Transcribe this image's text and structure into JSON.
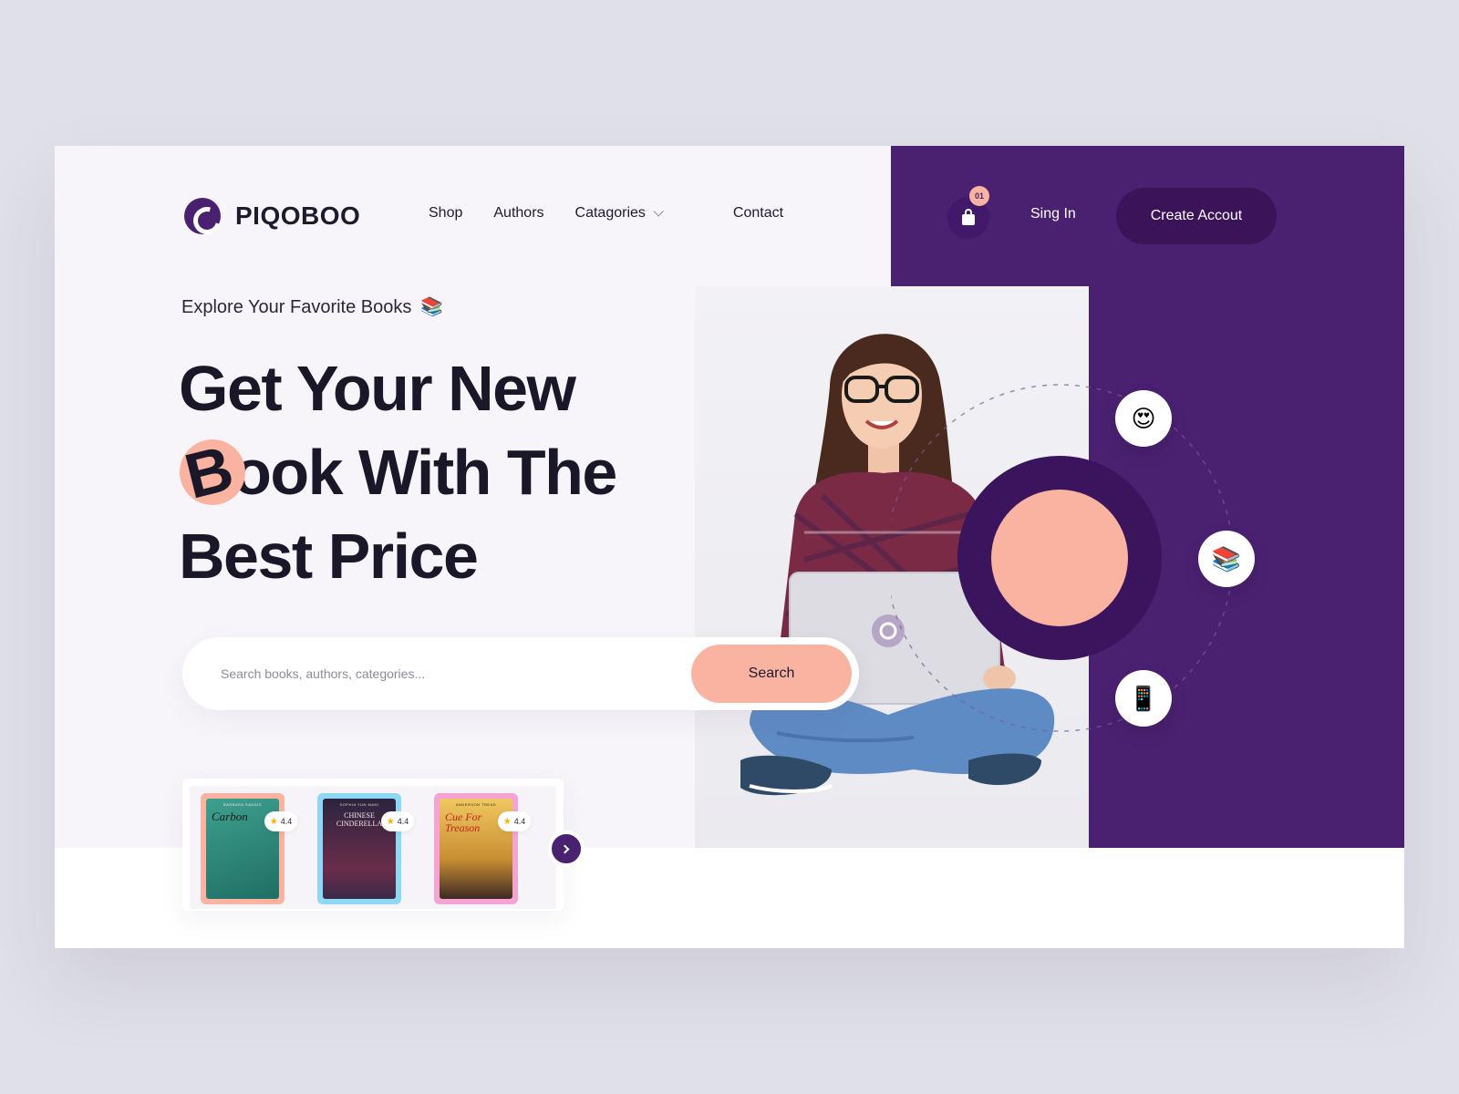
{
  "brand": {
    "name": "PIQOBOO"
  },
  "nav": {
    "items": [
      "Shop",
      "Authors",
      "Catagories",
      "Contact"
    ]
  },
  "header": {
    "cart_count": "01",
    "signin_label": "Sing In",
    "create_label": "Create Accout"
  },
  "hero": {
    "eyebrow": "Explore Your Favorite Books",
    "eyebrow_icon": "📚",
    "headline_line1": "Get Your New",
    "headline_b": "B",
    "headline_line2_rest": "ook With The",
    "headline_line3": "Best Price"
  },
  "search": {
    "placeholder": "Search books, authors, categories...",
    "button_label": "Search"
  },
  "books": [
    {
      "author": "BARBARA SANDIS",
      "title": "Carbon",
      "rating": "4.4",
      "accent": "#f9b3a0",
      "cover": "#2f8e7e",
      "title_color": "#1a1a1a"
    },
    {
      "author": "SOPHIA YUN MAHI",
      "title": "CHINESE CINDERELLA",
      "rating": "4.4",
      "accent": "#8fd8f3",
      "cover": "#3b2a4a",
      "title_color": "#f2e8e0"
    },
    {
      "author": "ANDERSON TREAD",
      "title": "Cue For Treason",
      "rating": "4.4",
      "accent": "#f5a3d2",
      "cover": "#e6b84a",
      "title_color": "#c4211c"
    }
  ],
  "orbit": {
    "icons": [
      "😍",
      "📚",
      "📱"
    ]
  },
  "colors": {
    "primary": "#4a2171",
    "accent": "#f9b3a0",
    "text": "#1a1828",
    "hero_bg": "#f7f5fa"
  }
}
